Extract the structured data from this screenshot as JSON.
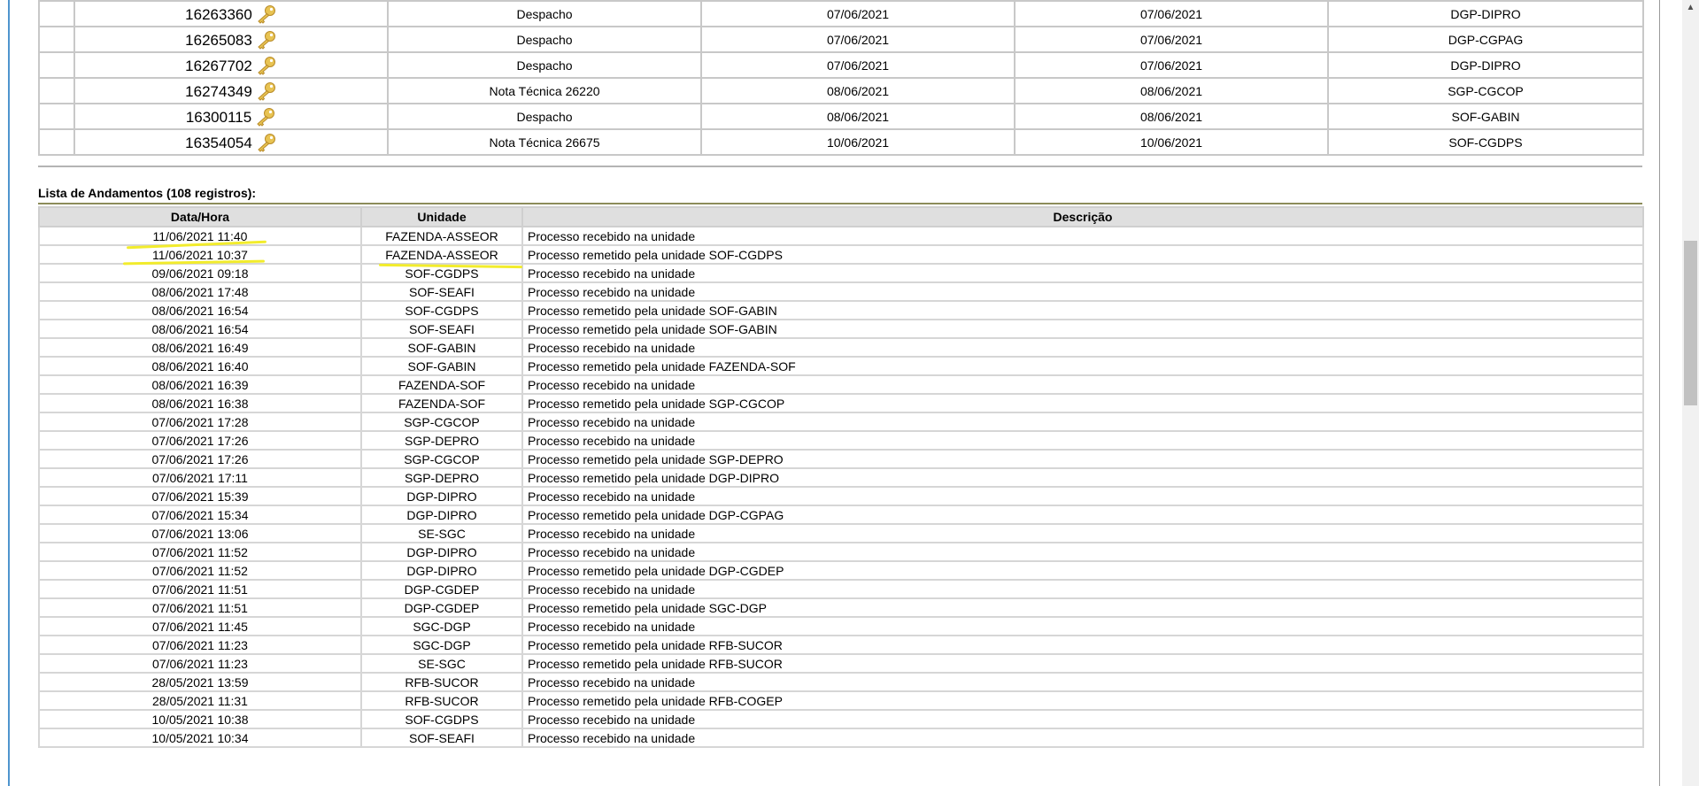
{
  "documents": [
    {
      "number": "16263360",
      "type": "Despacho",
      "date1": "07/06/2021",
      "date2": "07/06/2021",
      "unit": "DGP-DIPRO"
    },
    {
      "number": "16265083",
      "type": "Despacho",
      "date1": "07/06/2021",
      "date2": "07/06/2021",
      "unit": "DGP-CGPAG"
    },
    {
      "number": "16267702",
      "type": "Despacho",
      "date1": "07/06/2021",
      "date2": "07/06/2021",
      "unit": "DGP-DIPRO"
    },
    {
      "number": "16274349",
      "type": "Nota Técnica 26220",
      "date1": "08/06/2021",
      "date2": "08/06/2021",
      "unit": "SGP-CGCOP"
    },
    {
      "number": "16300115",
      "type": "Despacho",
      "date1": "08/06/2021",
      "date2": "08/06/2021",
      "unit": "SOF-GABIN"
    },
    {
      "number": "16354054",
      "type": "Nota Técnica 26675",
      "date1": "10/06/2021",
      "date2": "10/06/2021",
      "unit": "SOF-CGDPS"
    }
  ],
  "andamentos": {
    "caption": "Lista de Andamentos (108 registros):",
    "headers": {
      "datetime": "Data/Hora",
      "unit": "Unidade",
      "description": "Descrição"
    },
    "rows": [
      {
        "datetime": "11/06/2021 11:40",
        "unit": "FAZENDA-ASSEOR",
        "description": "Processo recebido na unidade"
      },
      {
        "datetime": "11/06/2021 10:37",
        "unit": "FAZENDA-ASSEOR",
        "description": "Processo remetido pela unidade SOF-CGDPS"
      },
      {
        "datetime": "09/06/2021 09:18",
        "unit": "SOF-CGDPS",
        "description": "Processo recebido na unidade"
      },
      {
        "datetime": "08/06/2021 17:48",
        "unit": "SOF-SEAFI",
        "description": "Processo recebido na unidade"
      },
      {
        "datetime": "08/06/2021 16:54",
        "unit": "SOF-CGDPS",
        "description": "Processo remetido pela unidade SOF-GABIN"
      },
      {
        "datetime": "08/06/2021 16:54",
        "unit": "SOF-SEAFI",
        "description": "Processo remetido pela unidade SOF-GABIN"
      },
      {
        "datetime": "08/06/2021 16:49",
        "unit": "SOF-GABIN",
        "description": "Processo recebido na unidade"
      },
      {
        "datetime": "08/06/2021 16:40",
        "unit": "SOF-GABIN",
        "description": "Processo remetido pela unidade FAZENDA-SOF"
      },
      {
        "datetime": "08/06/2021 16:39",
        "unit": "FAZENDA-SOF",
        "description": "Processo recebido na unidade"
      },
      {
        "datetime": "08/06/2021 16:38",
        "unit": "FAZENDA-SOF",
        "description": "Processo remetido pela unidade SGP-CGCOP"
      },
      {
        "datetime": "07/06/2021 17:28",
        "unit": "SGP-CGCOP",
        "description": "Processo recebido na unidade"
      },
      {
        "datetime": "07/06/2021 17:26",
        "unit": "SGP-DEPRO",
        "description": "Processo recebido na unidade"
      },
      {
        "datetime": "07/06/2021 17:26",
        "unit": "SGP-CGCOP",
        "description": "Processo remetido pela unidade SGP-DEPRO"
      },
      {
        "datetime": "07/06/2021 17:11",
        "unit": "SGP-DEPRO",
        "description": "Processo remetido pela unidade DGP-DIPRO"
      },
      {
        "datetime": "07/06/2021 15:39",
        "unit": "DGP-DIPRO",
        "description": "Processo recebido na unidade"
      },
      {
        "datetime": "07/06/2021 15:34",
        "unit": "DGP-DIPRO",
        "description": "Processo remetido pela unidade DGP-CGPAG"
      },
      {
        "datetime": "07/06/2021 13:06",
        "unit": "SE-SGC",
        "description": "Processo recebido na unidade"
      },
      {
        "datetime": "07/06/2021 11:52",
        "unit": "DGP-DIPRO",
        "description": "Processo recebido na unidade"
      },
      {
        "datetime": "07/06/2021 11:52",
        "unit": "DGP-DIPRO",
        "description": "Processo remetido pela unidade DGP-CGDEP"
      },
      {
        "datetime": "07/06/2021 11:51",
        "unit": "DGP-CGDEP",
        "description": "Processo recebido na unidade"
      },
      {
        "datetime": "07/06/2021 11:51",
        "unit": "DGP-CGDEP",
        "description": "Processo remetido pela unidade SGC-DGP"
      },
      {
        "datetime": "07/06/2021 11:45",
        "unit": "SGC-DGP",
        "description": "Processo recebido na unidade"
      },
      {
        "datetime": "07/06/2021 11:23",
        "unit": "SGC-DGP",
        "description": "Processo remetido pela unidade RFB-SUCOR"
      },
      {
        "datetime": "07/06/2021 11:23",
        "unit": "SE-SGC",
        "description": "Processo remetido pela unidade RFB-SUCOR"
      },
      {
        "datetime": "28/05/2021 13:59",
        "unit": "RFB-SUCOR",
        "description": "Processo recebido na unidade"
      },
      {
        "datetime": "28/05/2021 11:31",
        "unit": "RFB-SUCOR",
        "description": "Processo remetido pela unidade RFB-COGEP"
      },
      {
        "datetime": "10/05/2021 10:38",
        "unit": "SOF-CGDPS",
        "description": "Processo recebido na unidade"
      },
      {
        "datetime": "10/05/2021 10:34",
        "unit": "SOF-SEAFI",
        "description": "Processo recebido na unidade"
      }
    ]
  },
  "colors": {
    "highlight": "#f2ec2c",
    "key_icon": "#e8c352",
    "header_bg": "#dfdfdf",
    "left_rule": "#4f95ce"
  },
  "icons": {
    "document_key": "key-icon",
    "scroll_up": "scroll-up-arrow-icon"
  }
}
